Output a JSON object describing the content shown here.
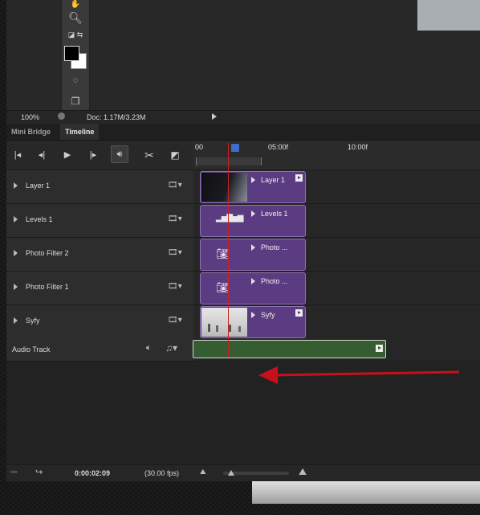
{
  "status": {
    "zoom": "100%",
    "doc_size": "Doc: 1.17M/3.23M"
  },
  "tabs": [
    {
      "label": "Mini Bridge",
      "active": false
    },
    {
      "label": "Timeline",
      "active": true
    }
  ],
  "controls": [
    {
      "icon": "go-to-first-frame-icon"
    },
    {
      "icon": "previous-frame-icon"
    },
    {
      "icon": "play-icon"
    },
    {
      "icon": "next-frame-icon"
    },
    {
      "icon": "audio-icon"
    },
    {
      "icon": "split-at-playhead-icon"
    },
    {
      "icon": "transition-icon"
    }
  ],
  "ruler": {
    "labels": [
      "00",
      "05:00f",
      "10:00f"
    ]
  },
  "layers": [
    {
      "name": "Layer 1",
      "clip_label": "Layer 1",
      "clip_thumb": "dark-gradient"
    },
    {
      "name": "Levels 1",
      "clip_label": "Levels 1",
      "clip_thumb": "levels-icon"
    },
    {
      "name": "Photo Filter 2",
      "clip_label": "Photo ...",
      "clip_thumb": "photo-filter-icon"
    },
    {
      "name": "Photo Filter 1",
      "clip_label": "Photo ...",
      "clip_thumb": "photo-filter-icon"
    },
    {
      "name": "Syfy",
      "clip_label": "Syfy",
      "clip_thumb": "grey-photo"
    }
  ],
  "audio": {
    "label": "Audio Track"
  },
  "footer": {
    "timecode": "0:00:02:09",
    "fps": "(30.00 fps)"
  },
  "colors": {
    "clip_purple": "#5b3c82",
    "audio_green": "#365c31",
    "playhead_red": "#cf1f1f",
    "annotation_arrow": "#c8101a"
  }
}
